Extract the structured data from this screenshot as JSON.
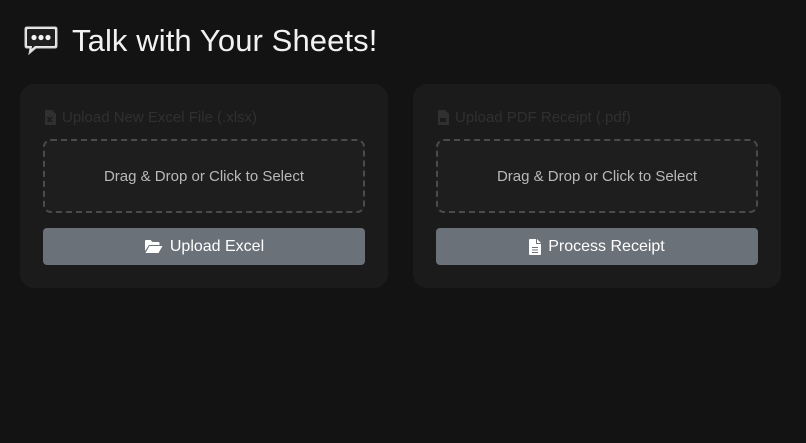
{
  "header": {
    "icon": "speech-bubble-icon",
    "title": "Talk with Your Sheets!"
  },
  "excel_card": {
    "label_icon": "excel-file-icon",
    "label": "Upload New Excel File (.xlsx)",
    "dropzone_text": "Drag & Drop or Click to Select",
    "button_icon": "folder-open-icon",
    "button_label": "Upload Excel"
  },
  "pdf_card": {
    "label_icon": "pdf-file-icon",
    "label": "Upload PDF Receipt (.pdf)",
    "dropzone_text": "Drag & Drop or Click to Select",
    "button_icon": "file-icon",
    "button_label": "Process Receipt"
  },
  "colors": {
    "background": "#131313",
    "card": "#1b1b1b",
    "button": "#6b7178",
    "label_muted": "#303030"
  }
}
